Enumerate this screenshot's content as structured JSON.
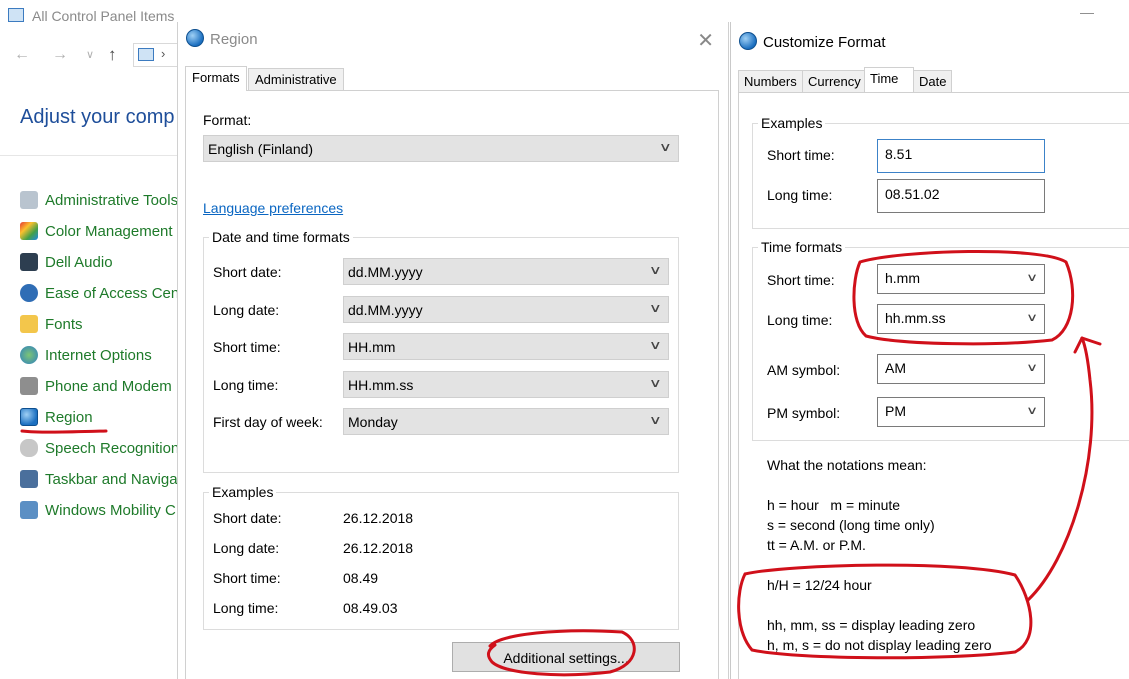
{
  "control_panel": {
    "title": "All Control Panel Items",
    "heading": "Adjust your comp",
    "items": [
      {
        "label": "Administrative Tools",
        "icon": "admin-tools-icon"
      },
      {
        "label": "Color Management",
        "icon": "color-management-icon"
      },
      {
        "label": "Dell Audio",
        "icon": "dell-audio-icon"
      },
      {
        "label": "Ease of Access Cent",
        "icon": "ease-of-access-icon"
      },
      {
        "label": "Fonts",
        "icon": "fonts-icon"
      },
      {
        "label": "Internet Options",
        "icon": "internet-options-icon"
      },
      {
        "label": "Phone and Modem",
        "icon": "phone-modem-icon"
      },
      {
        "label": "Region",
        "icon": "region-icon"
      },
      {
        "label": "Speech Recognition",
        "icon": "speech-recognition-icon"
      },
      {
        "label": "Taskbar and Navigat",
        "icon": "taskbar-icon"
      },
      {
        "label": "Windows Mobility C",
        "icon": "windows-mobility-icon"
      }
    ]
  },
  "region": {
    "title": "Region",
    "tabs": [
      "Formats",
      "Administrative"
    ],
    "format_label": "Format:",
    "format_value": "English (Finland)",
    "language_link": "Language preferences",
    "date_time_group": "Date and time formats",
    "fields": [
      {
        "label": "Short date:",
        "value": "dd.MM.yyyy"
      },
      {
        "label": "Long date:",
        "value": "dd.MM.yyyy"
      },
      {
        "label": "Short time:",
        "value": "HH.mm"
      },
      {
        "label": "Long time:",
        "value": "HH.mm.ss"
      },
      {
        "label": "First day of week:",
        "value": "Monday"
      }
    ],
    "examples_group": "Examples",
    "examples": [
      {
        "label": "Short date:",
        "value": "26.12.2018"
      },
      {
        "label": "Long date:",
        "value": "26.12.2018"
      },
      {
        "label": "Short time:",
        "value": "08.49"
      },
      {
        "label": "Long time:",
        "value": "08.49.03"
      }
    ],
    "additional_button": "Additional settings..."
  },
  "customize": {
    "title": "Customize Format",
    "tabs": [
      "Numbers",
      "Currency",
      "Time",
      "Date"
    ],
    "examples_group": "Examples",
    "examples": [
      {
        "label": "Short time:",
        "value": "8.51"
      },
      {
        "label": "Long time:",
        "value": "08.51.02"
      }
    ],
    "time_formats_group": "Time formats",
    "time_fields": [
      {
        "label": "Short time:",
        "value": "h.mm"
      },
      {
        "label": "Long time:",
        "value": "hh.mm.ss"
      },
      {
        "label": "AM symbol:",
        "value": "AM"
      },
      {
        "label": "PM symbol:",
        "value": "PM"
      }
    ],
    "notes": [
      "What the notations mean:",
      "h = hour   m = minute",
      "s = second (long time only)",
      "tt = A.M. or P.M.",
      "h/H = 12/24 hour",
      "hh, mm, ss = display leading zero",
      "h, m, s = do not display leading zero"
    ]
  },
  "colors": {
    "annotation": "#d0101a",
    "link": "#0a66c2",
    "cp_item": "#1e7a2a"
  }
}
